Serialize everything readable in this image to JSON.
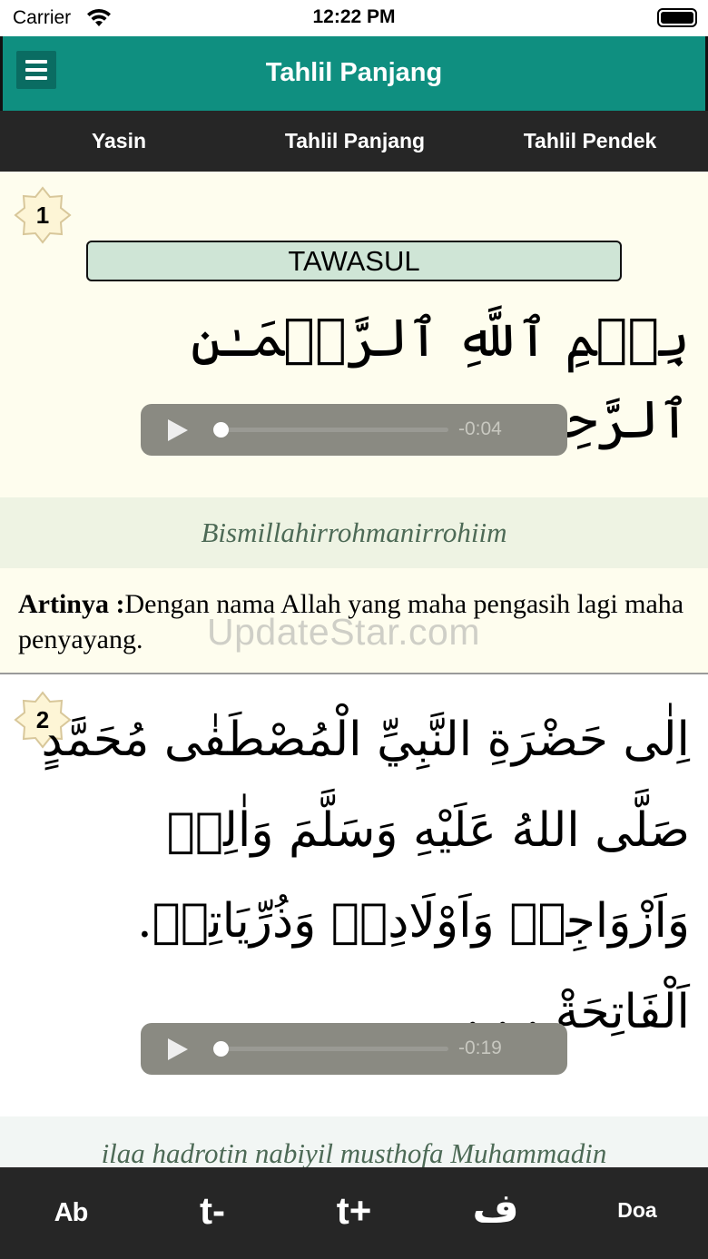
{
  "status_bar": {
    "carrier": "Carrier",
    "time": "12:22 PM"
  },
  "header": {
    "title": "Tahlil Panjang"
  },
  "tabs": [
    {
      "label": "Yasin"
    },
    {
      "label": "Tahlil Panjang"
    },
    {
      "label": "Tahlil Pendek"
    }
  ],
  "sections": [
    {
      "number": "1",
      "label": "TAWASUL",
      "arabic": "بِسۡمِ ٱللَّهِ ٱلرَّحۡمَـٰنِ ٱلرَّحِيمِ",
      "audio_time": "-0:04",
      "audio_progress": 0,
      "transliteration": "Bismillahirrohmanirrohiim",
      "meaning_label": "Artinya :",
      "meaning": "Dengan nama Allah yang maha pengasih lagi maha penyayang."
    },
    {
      "number": "2",
      "arabic": "اِلٰى حَضْرَةِ النَّبِيِّ الْمُصْطَفٰى مُحَمَّدٍ صَلَّى اللهُ عَلَيْهِ وَسَلَّمَ وَاٰلِهٖ وَاَزْوَاجِهٖ وَاَوْلَادِهٖ وَذُرِّيَاتِهٖ. اَلْفَاتِحَةْ . . .",
      "audio_time": "-0:19",
      "audio_progress": 0,
      "transliteration": "ilaa hadrotin nabiyil musthofa Muhammadin"
    }
  ],
  "watermark": "UpdateStar.com",
  "toolbar": {
    "ab": "Ab",
    "t_minus": "t-",
    "t_plus": "t+",
    "arabic_letter": "ف",
    "doa": "Doa"
  },
  "colors": {
    "header": "#0f8f80",
    "tabs_bg": "#262626",
    "label_bg": "#cfe5d6",
    "content_bg": "#fefdee"
  }
}
